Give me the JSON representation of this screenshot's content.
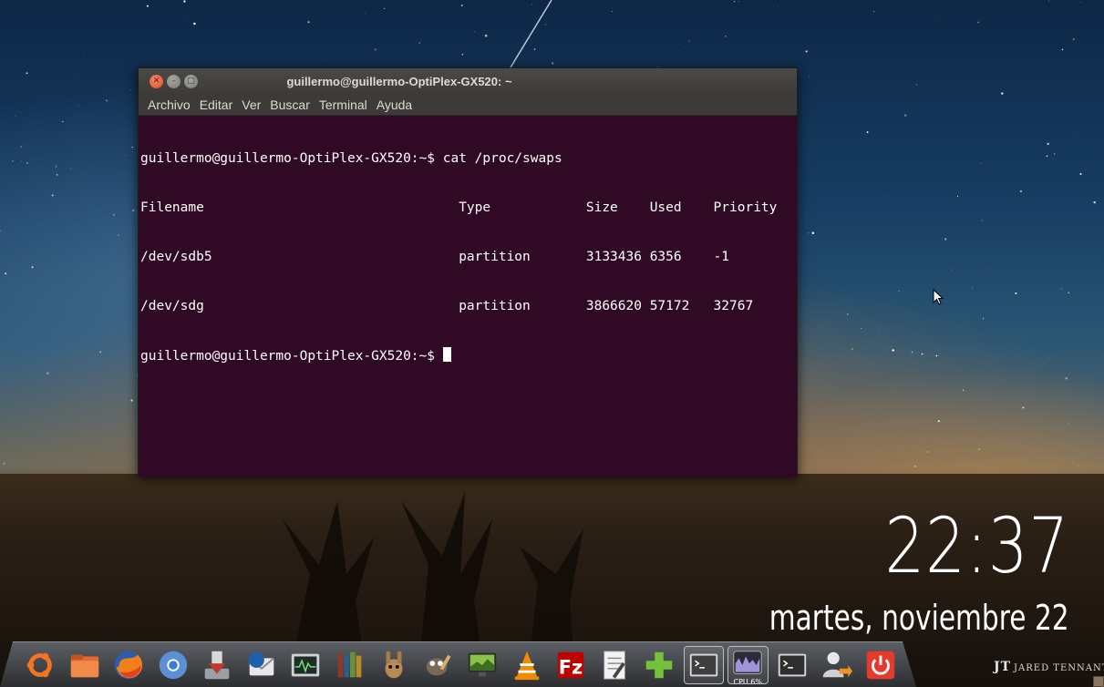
{
  "window": {
    "title": "guillermo@guillermo-OptiPlex-GX520: ~",
    "close_glyph": "✕",
    "min_glyph": "–",
    "max_glyph": "□"
  },
  "menu": [
    "Archivo",
    "Editar",
    "Ver",
    "Buscar",
    "Terminal",
    "Ayuda"
  ],
  "terminal": {
    "lines": [
      "guillermo@guillermo-OptiPlex-GX520:~$ cat /proc/swaps",
      "Filename                                Type            Size    Used    Priority",
      "/dev/sdb5                               partition       3133436 6356    -1",
      "/dev/sdg                                partition       3866620 57172   32767"
    ],
    "prompt": "guillermo@guillermo-OptiPlex-GX520:~$ "
  },
  "clock": {
    "time": "22:37",
    "date": "martes, noviembre 22"
  },
  "credit": {
    "mark": "JT",
    "text": "JARED TENNANT"
  },
  "dock": {
    "cpu_label": "CPU 6%",
    "icons": [
      "ubuntu-icon",
      "files-icon",
      "firefox-icon",
      "chromium-icon",
      "install-icon",
      "thunderbird-icon",
      "system-monitor-icon",
      "library-icon",
      "amule-icon",
      "gimp-icon",
      "display-icon",
      "vlc-icon",
      "filezilla-icon",
      "text-editor-icon",
      "add-icon",
      "terminal-icon",
      "cpu-monitor-icon",
      "terminal-icon-2",
      "user-logout-icon",
      "power-icon"
    ]
  },
  "colors": {
    "terminal_bg": "#300a24",
    "titlebar": "#3c3b37",
    "close_button": "#e2501e"
  }
}
